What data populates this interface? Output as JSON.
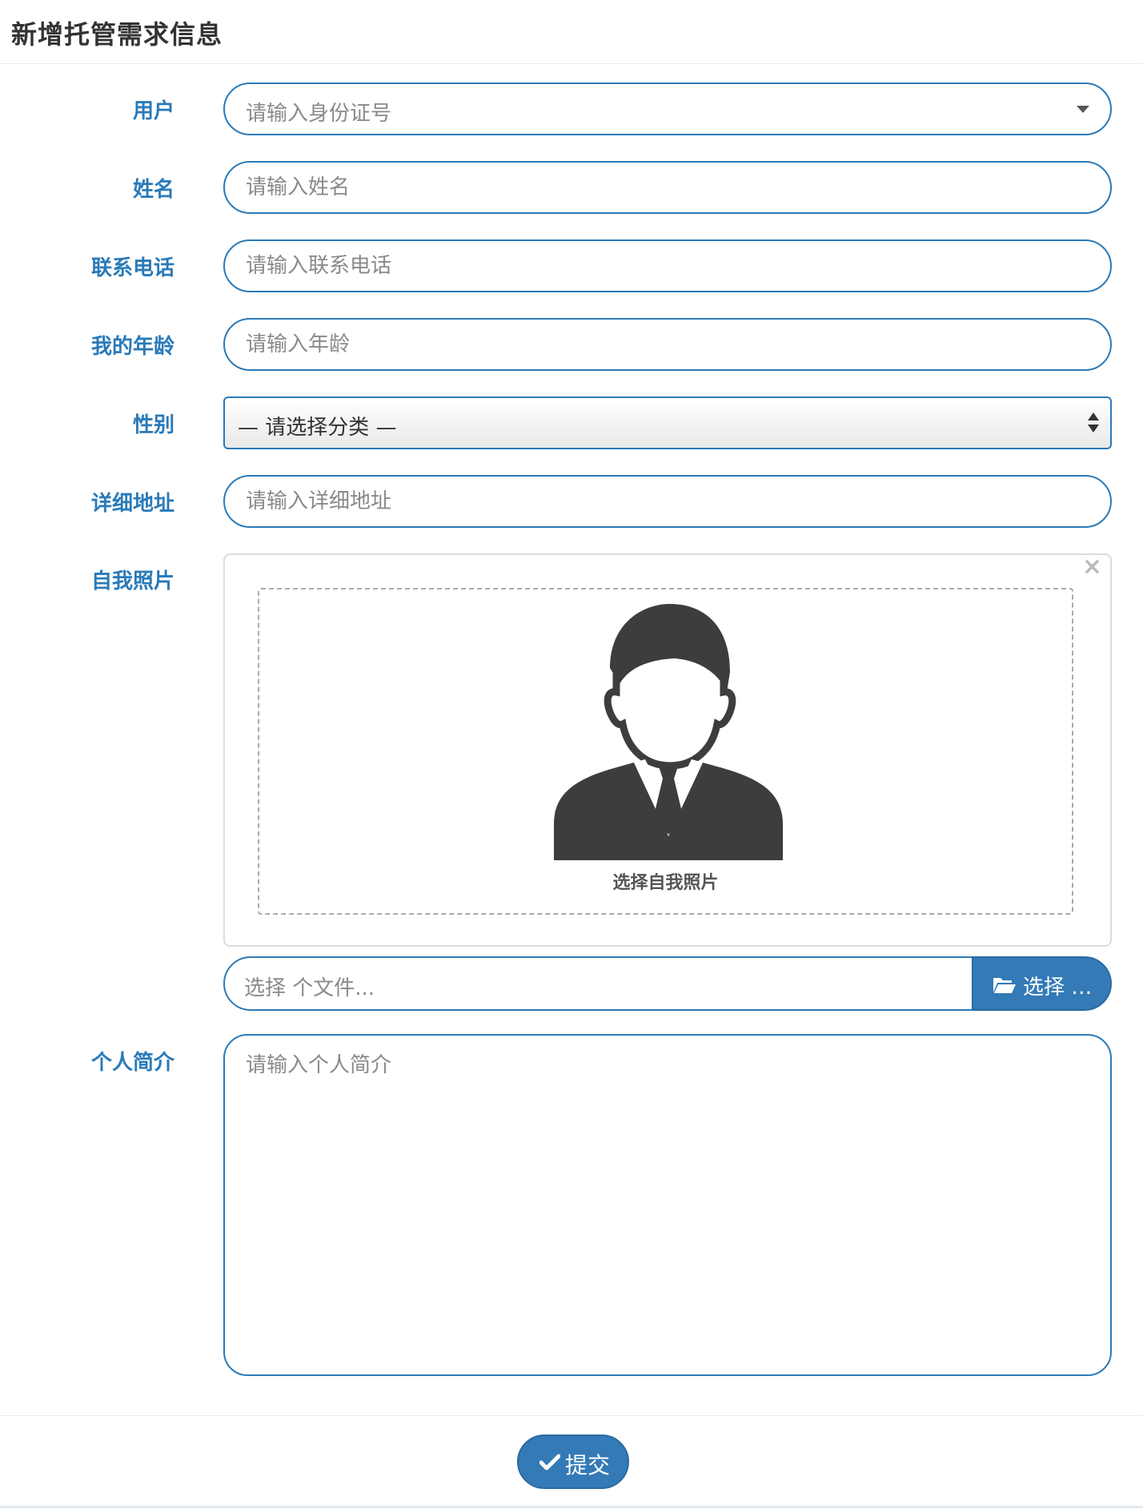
{
  "header": {
    "title": "新增托管需求信息"
  },
  "form": {
    "user": {
      "label": "用户",
      "placeholder": "请输入身份证号"
    },
    "name": {
      "label": "姓名",
      "placeholder": "请输入姓名"
    },
    "phone": {
      "label": "联系电话",
      "placeholder": "请输入联系电话"
    },
    "age": {
      "label": "我的年龄",
      "placeholder": "请输入年龄"
    },
    "gender": {
      "label": "性别",
      "selected": "— 请选择分类 —"
    },
    "address": {
      "label": "详细地址",
      "placeholder": "请输入详细地址"
    },
    "photo": {
      "label": "自我照片",
      "close": "×",
      "caption": "选择自我照片",
      "file_placeholder": "选择 个文件...",
      "browse_label": "选择 …"
    },
    "intro": {
      "label": "个人简介",
      "placeholder": "请输入个人简介"
    }
  },
  "footer": {
    "submit_label": "提交"
  },
  "colors": {
    "accent": "#2a7ab8",
    "button": "#337ab7"
  },
  "icons": {
    "user_dropdown": "caret-down-icon",
    "browse": "folder-open-icon",
    "submit": "check-icon",
    "avatar": "user-avatar-icon"
  }
}
